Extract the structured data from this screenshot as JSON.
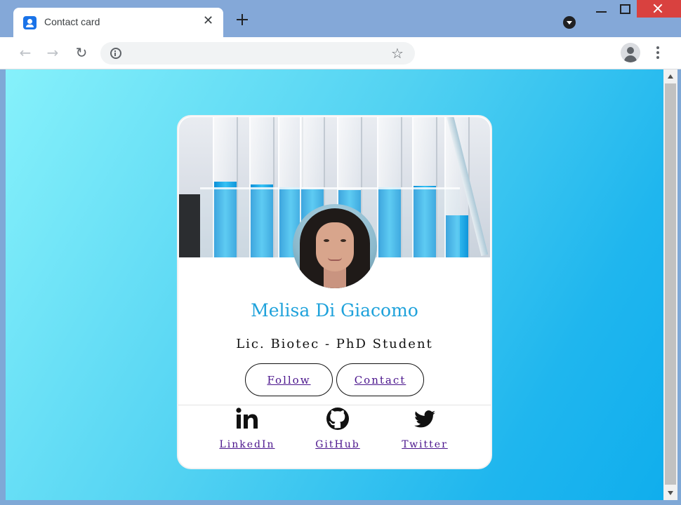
{
  "browser": {
    "tab_title": "Contact card",
    "tab_close_glyph": "✕",
    "nav_back_glyph": "←",
    "nav_forward_glyph": "→",
    "reload_glyph": "↻",
    "star_glyph": "☆"
  },
  "card": {
    "name": "Melisa Di Giacomo",
    "role": "Lic. Biotec - PhD Student",
    "follow_label": "Follow",
    "contact_label": "Contact",
    "social": [
      {
        "label": "LinkedIn",
        "icon": "linkedin-icon"
      },
      {
        "label": "GitHub",
        "icon": "github-icon"
      },
      {
        "label": "Twitter",
        "icon": "twitter-icon"
      }
    ]
  },
  "colors": {
    "name": "#1fa2db",
    "link": "#4a148c",
    "background_start": "#86f1fb",
    "background_end": "#10aeed"
  }
}
